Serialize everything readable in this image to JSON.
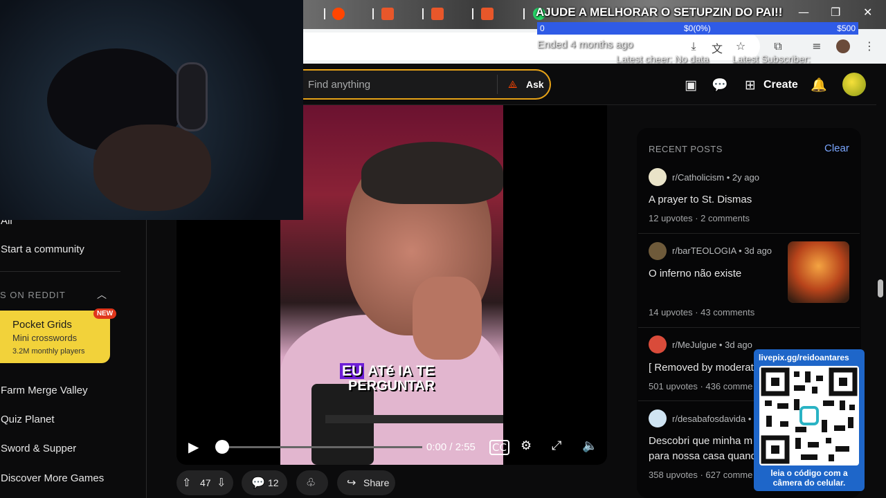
{
  "overlay": {
    "donation_title": "AJUDE A MELHORAR O SETUPZIN DO PAI!!",
    "donation_min": "0",
    "donation_current": "$0(0%)",
    "donation_max": "$500",
    "donation_ended": "Ended 4 months ago",
    "latest_cheer": "Latest cheer: No data",
    "latest_subscriber": "Latest Subscriber:"
  },
  "header": {
    "search_placeholder": "Find anything",
    "ask_label": "Ask",
    "create_label": "Create"
  },
  "sidebar": {
    "all_label": "All",
    "start_community": "Start a community",
    "games_heading": "S ON REDDIT",
    "pocket_grids": {
      "title": "Pocket Grids",
      "subtitle": "Mini crosswords",
      "players": "3.2M monthly players",
      "badge": "NEW"
    },
    "games": [
      "Farm Merge Valley",
      "Quiz Planet",
      "Sword & Supper",
      "Discover More Games"
    ]
  },
  "video": {
    "caption_line1_highlight": "EU",
    "caption_line1_rest": "ATé IA TE",
    "caption_line2": "PERGUNTAR",
    "time": "0:00 / 2:55",
    "progress": 0
  },
  "actions": {
    "votes": "47",
    "comments": "12",
    "share_label": "Share"
  },
  "recent_posts": {
    "title": "RECENT POSTS",
    "clear_label": "Clear",
    "items": [
      {
        "subreddit": "r/Catholicism",
        "age": "2y ago",
        "title": "A prayer to St. Dismas",
        "upvotes": "12 upvotes",
        "comments": "2 comments"
      },
      {
        "subreddit": "r/barTEOLOGIA",
        "age": "3d ago",
        "title": "O inferno não existe",
        "upvotes": "14 upvotes",
        "comments": "43 comments"
      },
      {
        "subreddit": "r/MeJulgue",
        "age": "3d ago",
        "title": "[ Removed by moderat",
        "upvotes": "501 upvotes",
        "comments": "436 comme"
      },
      {
        "subreddit": "r/desabafosdavida",
        "age": "",
        "title": "Descobri que minha m",
        "title2": "para nossa casa quand",
        "upvotes": "358 upvotes",
        "comments": "627 comme"
      }
    ]
  },
  "qr": {
    "url": "livepix.gg/reidoantares",
    "caption": "leia o código com a câmera do celular."
  },
  "colors": {
    "reddit_orange": "#ff4500",
    "search_border": "#e8a317",
    "donation_bar": "#2f5be6",
    "qr_panel": "#1e66c9",
    "pocket_card": "#f2d23a"
  }
}
